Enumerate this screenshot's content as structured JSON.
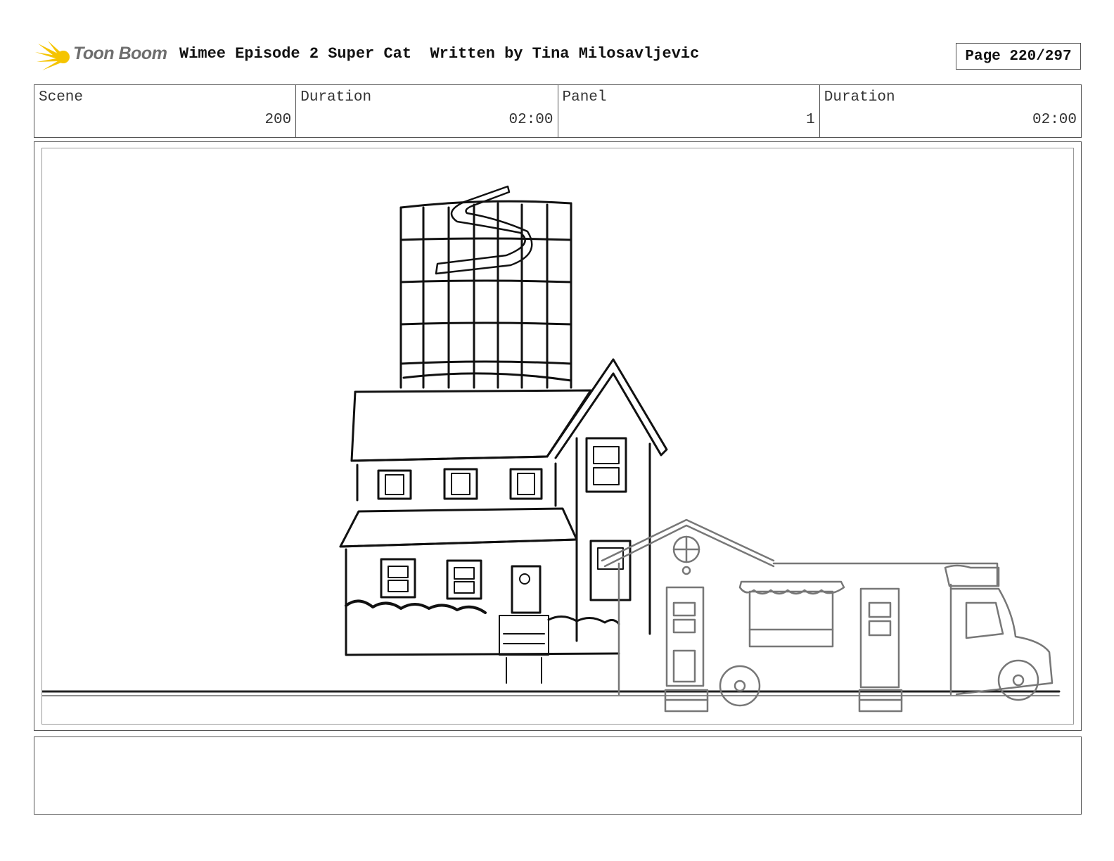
{
  "logo": {
    "text": "Toon Boom",
    "accent_color": "#f5c400"
  },
  "header": {
    "title": "Wimee Episode 2 Super Cat  Written by Tina Milosavljevic",
    "page": "Page 220/297"
  },
  "info": {
    "scene_label": "Scene",
    "scene_value": "200",
    "scene_duration_label": "Duration",
    "scene_duration_value": "02:00",
    "panel_label": "Panel",
    "panel_value": "1",
    "panel_duration_label": "Duration",
    "panel_duration_value": "02:00"
  },
  "panel": {
    "image_description_icon": "sketch-house-tower-foodtruck"
  },
  "notes": {}
}
